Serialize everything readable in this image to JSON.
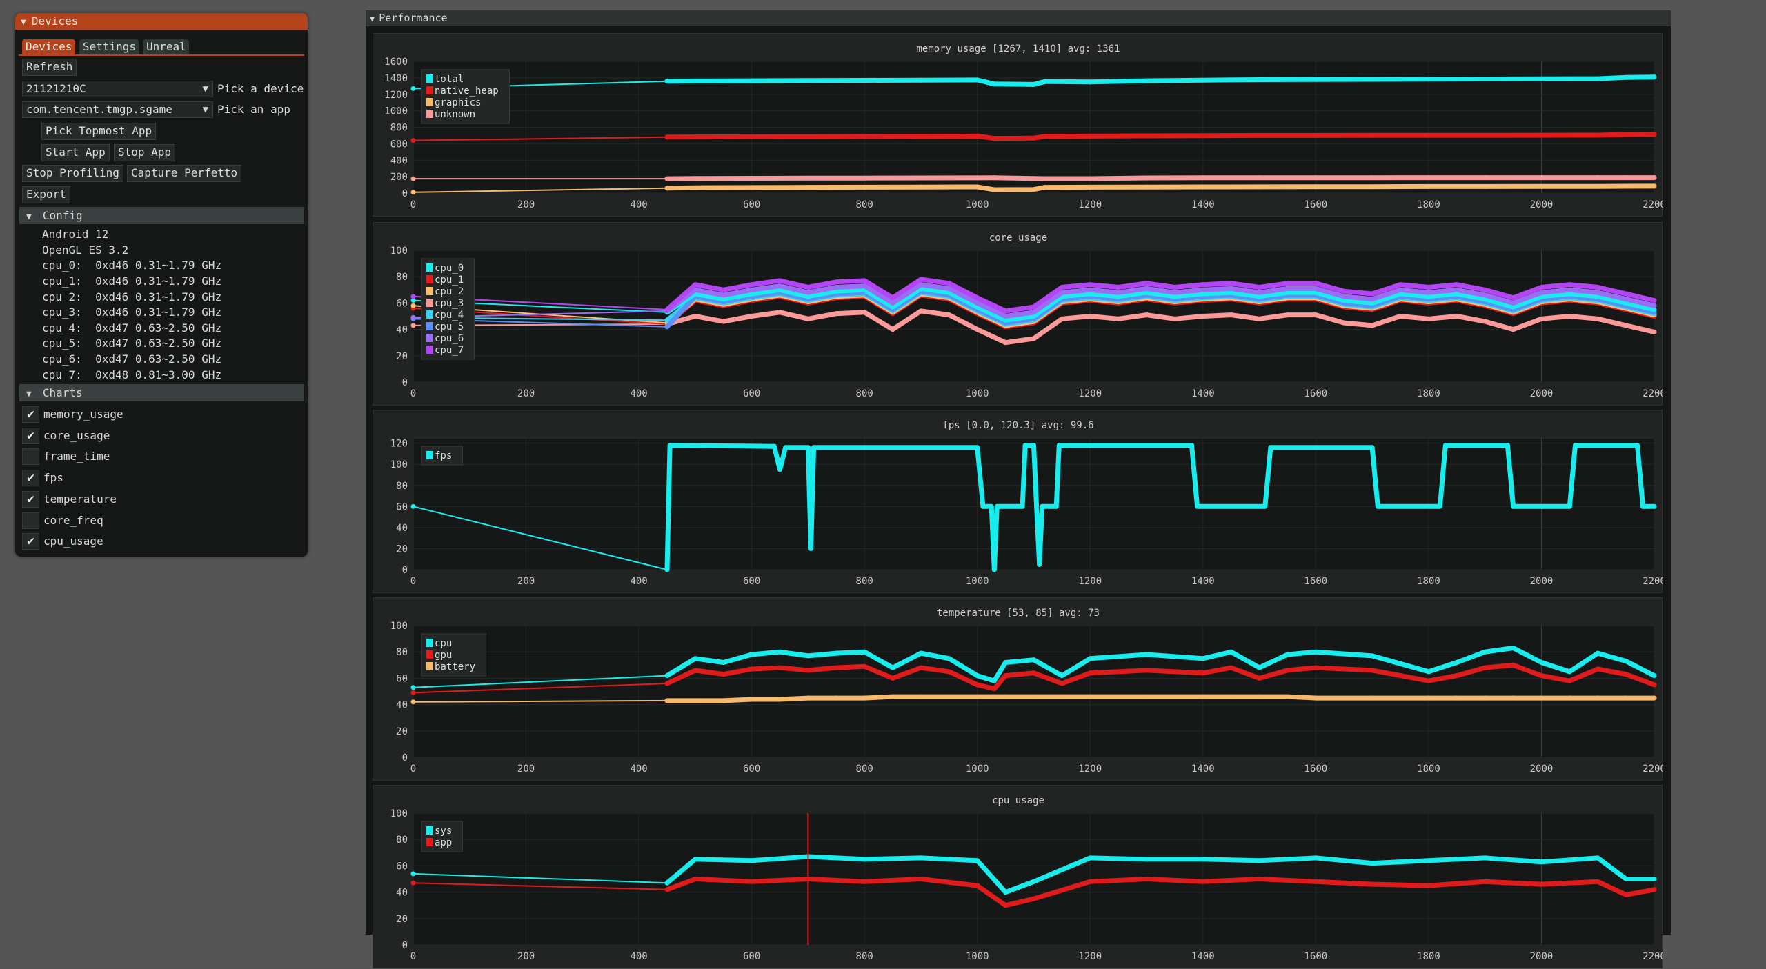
{
  "devices_window": {
    "title": "Devices",
    "tabs": [
      {
        "label": "Devices",
        "active": true
      },
      {
        "label": "Settings",
        "active": false
      },
      {
        "label": "Unreal",
        "active": false
      }
    ],
    "refresh_label": "Refresh",
    "device_combo": {
      "value": "21121210C",
      "label": "Pick a device"
    },
    "app_combo": {
      "value": "com.tencent.tmgp.sgame",
      "label": "Pick an app"
    },
    "pick_topmost_label": "Pick Topmost App",
    "start_app_label": "Start App",
    "stop_app_label": "Stop App",
    "stop_profiling_label": "Stop Profiling",
    "capture_perfetto_label": "Capture Perfetto",
    "export_label": "Export",
    "config": {
      "header": "Config",
      "lines": [
        "Android 12",
        "OpenGL ES 3.2",
        "cpu_0:  0xd46 0.31~1.79 GHz",
        "cpu_1:  0xd46 0.31~1.79 GHz",
        "cpu_2:  0xd46 0.31~1.79 GHz",
        "cpu_3:  0xd46 0.31~1.79 GHz",
        "cpu_4:  0xd47 0.63~2.50 GHz",
        "cpu_5:  0xd47 0.63~2.50 GHz",
        "cpu_6:  0xd47 0.63~2.50 GHz",
        "cpu_7:  0xd48 0.81~3.00 GHz"
      ]
    },
    "charts": {
      "header": "Charts",
      "items": [
        {
          "label": "memory_usage",
          "checked": true
        },
        {
          "label": "core_usage",
          "checked": true
        },
        {
          "label": "frame_time",
          "checked": false
        },
        {
          "label": "fps",
          "checked": true
        },
        {
          "label": "temperature",
          "checked": true
        },
        {
          "label": "core_freq",
          "checked": false
        },
        {
          "label": "cpu_usage",
          "checked": true
        }
      ]
    },
    "check_glyph": "✔",
    "collapse_glyph": "▼",
    "combo_arrow": "▼"
  },
  "performance_window": {
    "title": "Performance"
  },
  "chart_data": [
    {
      "type": "line",
      "title": "memory_usage [1267, 1410] avg: 1361",
      "xlim": [
        0,
        2200
      ],
      "ylim": [
        0,
        1600
      ],
      "xticks": [
        "0",
        "200",
        "400",
        "600",
        "800",
        "1000",
        "1200",
        "1400",
        "1600",
        "1800",
        "2000",
        "2200"
      ],
      "yticks": [
        "0",
        "200",
        "400",
        "600",
        "800",
        "1000",
        "1200",
        "1400",
        "1600"
      ],
      "grid": true,
      "legend": "top-left",
      "x": [
        0,
        450,
        500,
        600,
        700,
        800,
        900,
        1000,
        1030,
        1100,
        1120,
        1200,
        1300,
        1400,
        1500,
        1600,
        1700,
        1800,
        1900,
        2000,
        2100,
        2150,
        2200
      ],
      "series": [
        {
          "name": "total",
          "color": "#18ecec",
          "values": [
            1270,
            1360,
            1362,
            1365,
            1368,
            1370,
            1372,
            1375,
            1325,
            1320,
            1355,
            1350,
            1365,
            1372,
            1378,
            1380,
            1382,
            1384,
            1386,
            1388,
            1390,
            1405,
            1410
          ]
        },
        {
          "name": "native_heap",
          "color": "#e01b1c",
          "values": [
            640,
            680,
            682,
            684,
            686,
            688,
            690,
            692,
            665,
            668,
            690,
            692,
            695,
            698,
            700,
            700,
            701,
            702,
            702,
            703,
            704,
            712,
            714
          ]
        },
        {
          "name": "graphics",
          "color": "#f7b96c",
          "values": [
            10,
            60,
            65,
            68,
            70,
            72,
            74,
            75,
            42,
            44,
            70,
            72,
            74,
            75,
            76,
            78,
            78,
            80,
            80,
            82,
            82,
            84,
            85
          ]
        },
        {
          "name": "unknown",
          "color": "#f49a9a",
          "values": [
            175,
            175,
            178,
            180,
            182,
            183,
            184,
            185,
            186,
            178,
            176,
            176,
            184,
            186,
            186,
            187,
            187,
            188,
            188,
            188,
            188,
            188,
            188
          ]
        }
      ]
    },
    {
      "type": "line",
      "title": "core_usage",
      "xlim": [
        0,
        2200
      ],
      "ylim": [
        0,
        100
      ],
      "xticks": [
        "0",
        "200",
        "400",
        "600",
        "800",
        "1000",
        "1200",
        "1400",
        "1600",
        "1800",
        "2000",
        "2200"
      ],
      "yticks": [
        "0",
        "20",
        "40",
        "60",
        "80",
        "100"
      ],
      "grid": true,
      "legend": "top-left",
      "x": [
        0,
        450,
        500,
        550,
        600,
        650,
        700,
        750,
        800,
        850,
        900,
        950,
        1000,
        1050,
        1100,
        1150,
        1200,
        1250,
        1300,
        1350,
        1400,
        1450,
        1500,
        1550,
        1600,
        1650,
        1700,
        1750,
        1800,
        1850,
        1900,
        1950,
        2000,
        2050,
        2100,
        2150,
        2200
      ],
      "series": [
        {
          "name": "cpu_3",
          "color": "#fb9a99",
          "values": [
            43,
            44,
            50,
            46,
            50,
            53,
            48,
            52,
            53,
            40,
            54,
            51,
            40,
            30,
            33,
            48,
            50,
            48,
            51,
            48,
            50,
            51,
            48,
            51,
            51,
            45,
            43,
            50,
            48,
            50,
            46,
            40,
            48,
            50,
            48,
            43,
            38
          ]
        },
        {
          "name": "cpu_1",
          "color": "#e31a1c",
          "values": [
            56,
            44,
            62,
            58,
            62,
            65,
            60,
            64,
            65,
            52,
            66,
            63,
            52,
            42,
            45,
            60,
            62,
            60,
            63,
            60,
            62,
            63,
            60,
            63,
            63,
            57,
            55,
            62,
            60,
            62,
            58,
            52,
            60,
            62,
            60,
            55,
            50
          ]
        },
        {
          "name": "cpu_2",
          "color": "#fdbf6f",
          "values": [
            58,
            45,
            63,
            59,
            63,
            66,
            61,
            65,
            66,
            53,
            67,
            64,
            53,
            43,
            46,
            61,
            63,
            61,
            64,
            61,
            63,
            64,
            61,
            64,
            64,
            58,
            56,
            63,
            61,
            63,
            59,
            53,
            61,
            63,
            61,
            56,
            51
          ]
        },
        {
          "name": "cpu_4",
          "color": "#3ad0f5",
          "values": [
            49,
            47,
            64,
            60,
            64,
            67,
            62,
            66,
            67,
            54,
            68,
            65,
            54,
            44,
            47,
            62,
            64,
            62,
            65,
            62,
            64,
            65,
            62,
            65,
            65,
            59,
            57,
            64,
            62,
            64,
            60,
            54,
            62,
            64,
            62,
            57,
            52
          ]
        },
        {
          "name": "cpu_5",
          "color": "#5b8ff9",
          "values": [
            48,
            42,
            65,
            61,
            65,
            68,
            63,
            67,
            68,
            55,
            69,
            66,
            55,
            45,
            48,
            63,
            65,
            63,
            66,
            63,
            65,
            66,
            63,
            66,
            66,
            60,
            58,
            65,
            63,
            65,
            61,
            55,
            63,
            65,
            63,
            58,
            53
          ]
        },
        {
          "name": "cpu_0",
          "color": "#18ecec",
          "values": [
            62,
            53,
            67,
            63,
            67,
            70,
            65,
            69,
            70,
            57,
            71,
            68,
            57,
            47,
            50,
            65,
            67,
            65,
            68,
            65,
            67,
            68,
            65,
            68,
            68,
            62,
            60,
            67,
            65,
            67,
            63,
            57,
            65,
            67,
            65,
            60,
            55
          ]
        },
        {
          "name": "cpu_6",
          "color": "#9b6cf5",
          "values": [
            49,
            54,
            70,
            66,
            70,
            73,
            68,
            72,
            73,
            60,
            74,
            71,
            60,
            50,
            53,
            68,
            70,
            68,
            71,
            68,
            70,
            71,
            68,
            71,
            71,
            65,
            63,
            70,
            68,
            70,
            66,
            60,
            68,
            70,
            68,
            63,
            58
          ]
        },
        {
          "name": "cpu_7",
          "color": "#b445f5",
          "values": [
            65,
            55,
            74,
            70,
            74,
            77,
            72,
            76,
            77,
            64,
            78,
            75,
            64,
            54,
            57,
            72,
            74,
            72,
            75,
            72,
            74,
            75,
            72,
            75,
            75,
            69,
            67,
            74,
            72,
            74,
            70,
            64,
            72,
            74,
            72,
            67,
            62
          ]
        }
      ],
      "legend_order": [
        "cpu_0",
        "cpu_1",
        "cpu_2",
        "cpu_3",
        "cpu_4",
        "cpu_5",
        "cpu_6",
        "cpu_7"
      ]
    },
    {
      "type": "line",
      "title": "fps [0.0, 120.3] avg: 99.6",
      "xlim": [
        0,
        2200
      ],
      "ylim": [
        0,
        125
      ],
      "xticks": [
        "0",
        "200",
        "400",
        "600",
        "800",
        "1000",
        "1200",
        "1400",
        "1600",
        "1800",
        "2000",
        "2200"
      ],
      "yticks": [
        "0",
        "20",
        "40",
        "60",
        "80",
        "100",
        "120"
      ],
      "grid": true,
      "legend": "top-left",
      "x": [
        0,
        450,
        455,
        640,
        650,
        660,
        700,
        705,
        710,
        1000,
        1010,
        1025,
        1030,
        1035,
        1080,
        1085,
        1100,
        1105,
        1110,
        1115,
        1140,
        1145,
        1380,
        1390,
        1510,
        1520,
        1700,
        1710,
        1820,
        1830,
        1940,
        1950,
        2050,
        2060,
        2170,
        2180,
        2200
      ],
      "series": [
        {
          "name": "fps",
          "color": "#18ecec",
          "values": [
            60,
            0,
            118,
            117,
            95,
            116,
            116,
            20,
            116,
            116,
            60,
            60,
            0,
            60,
            60,
            118,
            118,
            60,
            5,
            60,
            60,
            118,
            118,
            60,
            60,
            116,
            116,
            60,
            60,
            118,
            118,
            60,
            60,
            118,
            118,
            60,
            60
          ]
        }
      ]
    },
    {
      "type": "line",
      "title": "temperature [53, 85] avg: 73",
      "xlim": [
        0,
        2200
      ],
      "ylim": [
        0,
        100
      ],
      "xticks": [
        "0",
        "200",
        "400",
        "600",
        "800",
        "1000",
        "1200",
        "1400",
        "1600",
        "1800",
        "2000",
        "2200"
      ],
      "yticks": [
        "0",
        "20",
        "40",
        "60",
        "80",
        "100"
      ],
      "grid": true,
      "legend": "top-left",
      "x": [
        0,
        450,
        500,
        550,
        600,
        650,
        700,
        750,
        800,
        850,
        900,
        950,
        1000,
        1030,
        1050,
        1100,
        1150,
        1200,
        1300,
        1400,
        1450,
        1500,
        1550,
        1600,
        1700,
        1800,
        1850,
        1900,
        1950,
        2000,
        2050,
        2100,
        2150,
        2200
      ],
      "series": [
        {
          "name": "battery",
          "color": "#f7b96c",
          "values": [
            42,
            43,
            43,
            43,
            44,
            44,
            45,
            45,
            45,
            46,
            46,
            46,
            46,
            46,
            46,
            46,
            46,
            46,
            46,
            46,
            46,
            46,
            46,
            45,
            45,
            45,
            45,
            45,
            45,
            45,
            45,
            45,
            45,
            45
          ]
        },
        {
          "name": "gpu",
          "color": "#e01b1c",
          "values": [
            49,
            56,
            66,
            63,
            67,
            68,
            66,
            68,
            69,
            60,
            68,
            65,
            55,
            52,
            62,
            64,
            56,
            64,
            66,
            64,
            68,
            60,
            66,
            68,
            66,
            58,
            62,
            68,
            70,
            62,
            58,
            67,
            63,
            55
          ]
        },
        {
          "name": "cpu",
          "color": "#18ecec",
          "values": [
            53,
            62,
            75,
            72,
            78,
            80,
            77,
            79,
            80,
            68,
            79,
            75,
            62,
            58,
            72,
            74,
            62,
            75,
            78,
            75,
            80,
            68,
            78,
            80,
            77,
            65,
            72,
            80,
            83,
            72,
            65,
            79,
            73,
            62
          ]
        }
      ],
      "legend_order": [
        "cpu",
        "gpu",
        "battery"
      ]
    },
    {
      "type": "line",
      "title": "cpu_usage",
      "xlim": [
        0,
        2200
      ],
      "ylim": [
        0,
        100
      ],
      "xticks": [
        "0",
        "200",
        "400",
        "600",
        "800",
        "1000",
        "1200",
        "1400",
        "1600",
        "1800",
        "2000",
        "2200"
      ],
      "yticks": [
        "0",
        "20",
        "40",
        "60",
        "80",
        "100"
      ],
      "grid": true,
      "legend": "top-left",
      "vline_x": 700,
      "x": [
        0,
        450,
        500,
        600,
        700,
        800,
        900,
        1000,
        1050,
        1100,
        1200,
        1300,
        1400,
        1500,
        1600,
        1700,
        1800,
        1900,
        2000,
        2100,
        2150,
        2200
      ],
      "series": [
        {
          "name": "sys",
          "color": "#18ecec",
          "values": [
            54,
            47,
            65,
            64,
            67,
            65,
            66,
            64,
            40,
            48,
            66,
            65,
            65,
            64,
            66,
            62,
            64,
            66,
            63,
            66,
            50,
            50
          ]
        },
        {
          "name": "app",
          "color": "#e01b1c",
          "values": [
            47,
            42,
            50,
            48,
            50,
            48,
            50,
            45,
            30,
            35,
            48,
            50,
            48,
            50,
            48,
            46,
            45,
            48,
            46,
            48,
            38,
            42
          ]
        }
      ],
      "legend_order": [
        "sys",
        "app"
      ]
    }
  ]
}
